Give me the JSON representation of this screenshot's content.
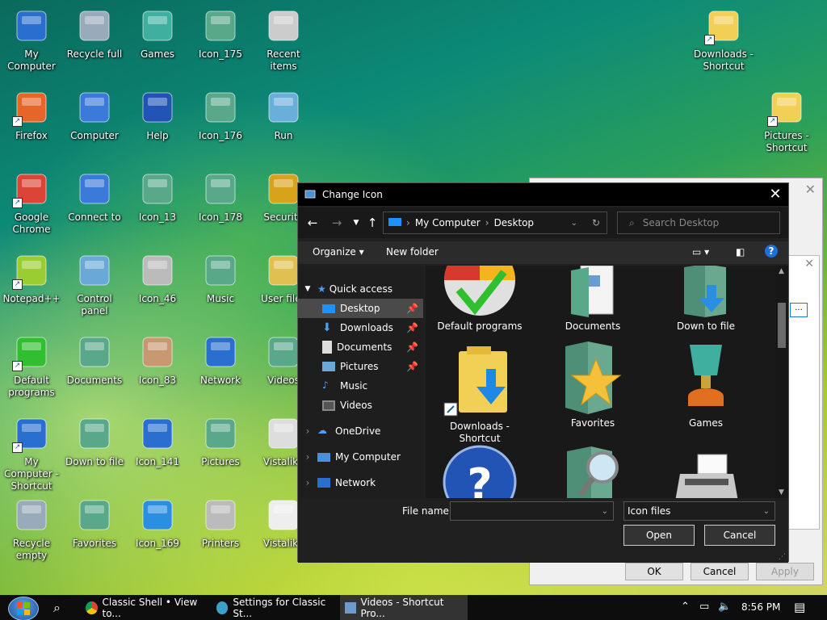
{
  "desktop": {
    "icons": [
      {
        "label": "My Computer",
        "icon": "monitor-icon"
      },
      {
        "label": "Recycle full",
        "icon": "recycle-bin-icon"
      },
      {
        "label": "Games",
        "icon": "trophy-icon"
      },
      {
        "label": "Icon_175",
        "icon": "folder-icon"
      },
      {
        "label": "Recent items",
        "icon": "recent-items-icon"
      },
      {
        "label": "Firefox",
        "icon": "firefox-icon"
      },
      {
        "label": "Computer",
        "icon": "computer-icon"
      },
      {
        "label": "Help",
        "icon": "help-icon"
      },
      {
        "label": "Icon_176",
        "icon": "folder-icon"
      },
      {
        "label": "Run",
        "icon": "run-icon"
      },
      {
        "label": "Google Chrome",
        "icon": "chrome-icon"
      },
      {
        "label": "Connect to",
        "icon": "connect-icon"
      },
      {
        "label": "Icon_13",
        "icon": "search-folder-icon"
      },
      {
        "label": "Icon_178",
        "icon": "folder-icon"
      },
      {
        "label": "Security",
        "icon": "lock-icon"
      },
      {
        "label": "Notepad++",
        "icon": "notepad-icon"
      },
      {
        "label": "Control panel",
        "icon": "control-panel-icon"
      },
      {
        "label": "Icon_46",
        "icon": "printer-icon"
      },
      {
        "label": "Music",
        "icon": "music-icon"
      },
      {
        "label": "User files",
        "icon": "user-folder-icon"
      },
      {
        "label": "Default programs",
        "icon": "default-programs-icon"
      },
      {
        "label": "Documents",
        "icon": "documents-icon"
      },
      {
        "label": "Icon_83",
        "icon": "users-icon"
      },
      {
        "label": "Network",
        "icon": "network-icon"
      },
      {
        "label": "Videos",
        "icon": "videos-icon"
      },
      {
        "label": "My Computer - Shortcut",
        "icon": "monitor-icon"
      },
      {
        "label": "Down to file",
        "icon": "download-folder-icon"
      },
      {
        "label": "Icon_141",
        "icon": "network-icon"
      },
      {
        "label": "Pictures",
        "icon": "pictures-icon"
      },
      {
        "label": "Vistalike",
        "icon": "paint-icon"
      },
      {
        "label": "Recycle empty",
        "icon": "recycle-bin-icon"
      },
      {
        "label": "Favorites",
        "icon": "favorites-icon"
      },
      {
        "label": "Icon_169",
        "icon": "globe-icon"
      },
      {
        "label": "Printers",
        "icon": "printers-icon"
      },
      {
        "label": "Vistalike",
        "icon": "document-icon"
      },
      {
        "label": "Downloads - Shortcut",
        "icon": "downloads-folder-icon"
      },
      {
        "label": "Pictures - Shortcut",
        "icon": "pictures-folder-icon"
      }
    ]
  },
  "dialog": {
    "title": "Change Icon",
    "breadcrumb": [
      "My Computer",
      "Desktop"
    ],
    "search_placeholder": "Search Desktop",
    "toolbar": {
      "organize": "Organize",
      "new_folder": "New folder"
    },
    "nav": {
      "quick_access": "Quick access",
      "items": [
        "Desktop",
        "Downloads",
        "Documents",
        "Pictures",
        "Music",
        "Videos"
      ],
      "onedrive": "OneDrive",
      "my_computer": "My Computer",
      "network": "Network"
    },
    "files": [
      "Default programs",
      "Documents",
      "Down to file",
      "Downloads - Shortcut",
      "Favorites",
      "Games"
    ],
    "file_name_label": "File name:",
    "file_name_value": "",
    "file_type": "Icon files",
    "open": "Open",
    "cancel": "Cancel"
  },
  "back_dialog": {
    "ok": "OK",
    "cancel": "Cancel",
    "apply": "Apply",
    "browse": "..."
  },
  "taskbar": {
    "items": [
      "Classic Shell • View to...",
      "Settings for Classic St...",
      "Videos - Shortcut Pro..."
    ],
    "time": "8:56 PM"
  }
}
